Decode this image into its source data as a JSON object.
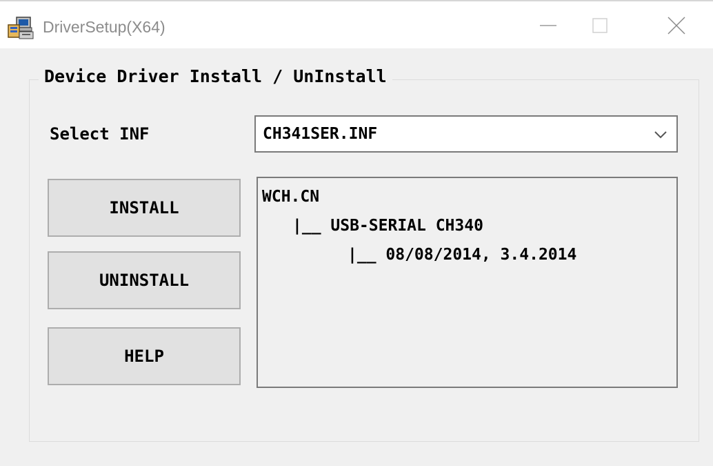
{
  "window": {
    "title": "DriverSetup(X64)",
    "app_icon": "setup-computer-icon",
    "controls": {
      "minimize_icon": "minimize-icon",
      "maximize_icon": "maximize-icon",
      "close_icon": "close-icon"
    }
  },
  "group": {
    "legend": "Device Driver Install / UnInstall"
  },
  "select_inf": {
    "label": "Select INF",
    "value": "CH341SER.INF",
    "arrow_icon": "chevron-down-icon"
  },
  "buttons": {
    "install": "INSTALL",
    "uninstall": "UNINSTALL",
    "help": "HELP"
  },
  "info": {
    "lines": [
      "WCH.CN",
      "|__ USB-SERIAL CH340",
      "|__ 08/08/2014, 3.4.2014"
    ]
  },
  "colors": {
    "title_bg": "#ffffff",
    "dialog_bg": "#f0f0f0",
    "button_bg": "#e1e1e1",
    "title_text": "#8c8c8c"
  }
}
